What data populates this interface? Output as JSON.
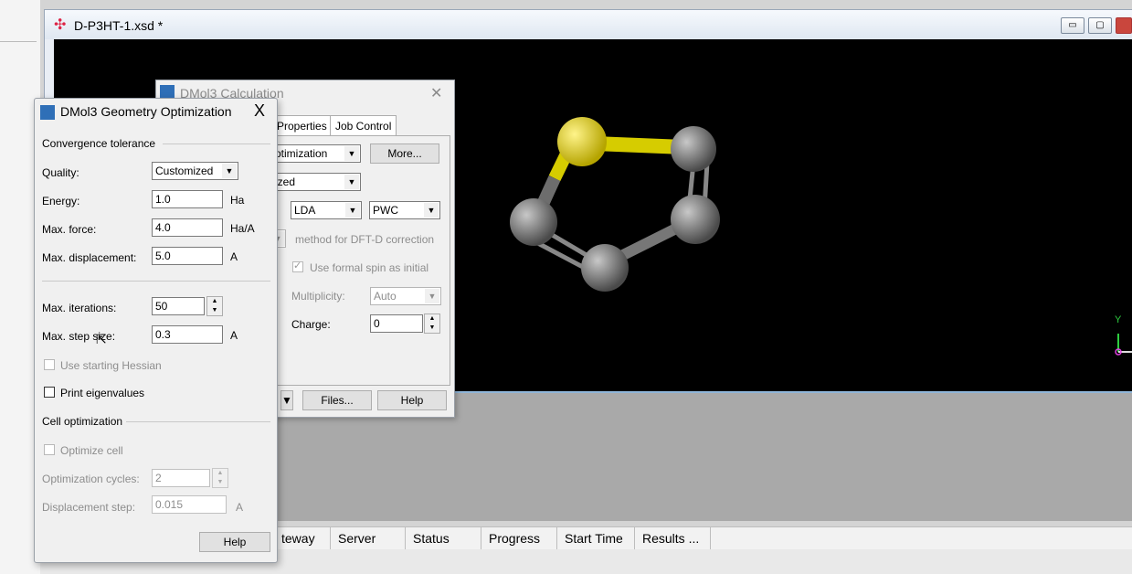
{
  "document": {
    "title": "D-P3HT-1.xsd *"
  },
  "axis": {
    "y_label": "Y"
  },
  "jobs_table": {
    "columns": [
      "teway",
      "Server",
      "Status",
      "Progress",
      "Start Time",
      "Results ..."
    ]
  },
  "calc_dialog": {
    "title": "DMol3 Calculation",
    "tabs": [
      "Properties",
      "Job Control"
    ],
    "task_value": "ptimization",
    "more_button": "More...",
    "quality_value": "ized",
    "functional_value": "LDA",
    "functional2_value": "PWC",
    "dftd_label": "method for DFT-D correction",
    "use_spin_label": "Use formal spin as initial",
    "multiplicity_label": "Multiplicity:",
    "multiplicity_value": "Auto",
    "charge_label": "Charge:",
    "charge_value": "0",
    "files_button": "Files...",
    "help_button": "Help"
  },
  "geom_dialog": {
    "title": "DMol3 Geometry Optimization",
    "close": "X",
    "convergence_header": "Convergence tolerance",
    "quality_label": "Quality:",
    "quality_value": "Customized",
    "energy_label": "Energy:",
    "energy_value": "1.0",
    "energy_unit": "Ha",
    "force_label": "Max. force:",
    "force_value": "4.0",
    "force_unit": "Ha/A",
    "disp_label": "Max. displacement:",
    "disp_value": "5.0",
    "disp_unit": "A",
    "iter_label": "Max. iterations:",
    "iter_value": "50",
    "step_label": "Max. step size:",
    "step_value": "0.3",
    "step_unit": "A",
    "hessian_label": "Use starting Hessian",
    "eigen_label": "Print eigenvalues",
    "cell_header": "Cell optimization",
    "optimize_cell_label": "Optimize cell",
    "cycles_label": "Optimization cycles:",
    "cycles_value": "2",
    "dstep_label": "Displacement step:",
    "dstep_value": "0.015",
    "dstep_unit": "A",
    "help_button": "Help"
  }
}
